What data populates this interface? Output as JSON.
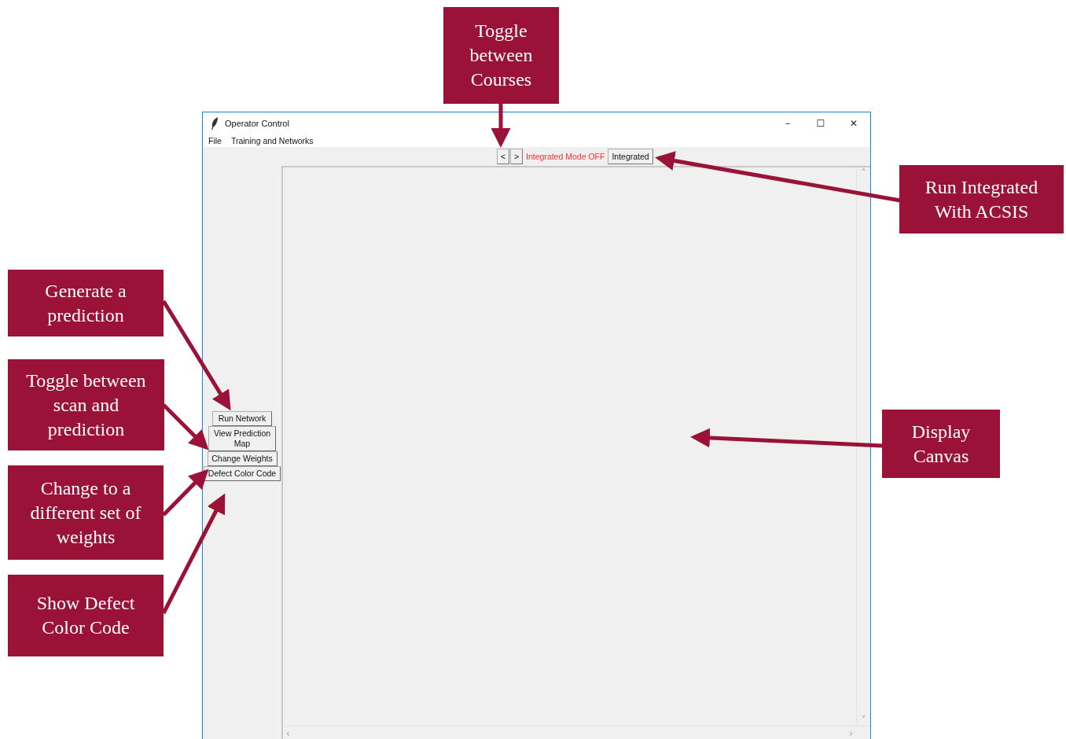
{
  "window": {
    "title": "Operator Control",
    "controls": [
      "–",
      "☐",
      "✕"
    ]
  },
  "menu": [
    "File",
    "Training and Networks"
  ],
  "toolbar": {
    "prev": "<",
    "next": ">",
    "mode_label": "Integrated Mode OFF",
    "integrated_button": "Integrated"
  },
  "side_buttons": [
    "Run Network",
    "View Prediction Map",
    "Change Weights",
    "Defect Color Code"
  ],
  "scrollbar": {
    "up": "˄",
    "down": "˅",
    "left": "‹",
    "right": "›"
  },
  "callouts": [
    {
      "text": "Toggle between Courses"
    },
    {
      "text": "Run Integrated With ACSIS"
    },
    {
      "text": "Generate a prediction"
    },
    {
      "text": "Toggle between scan and prediction"
    },
    {
      "text": "Change to a different set of weights"
    },
    {
      "text": "Show Defect Color Code"
    },
    {
      "text": "Display Canvas"
    }
  ]
}
